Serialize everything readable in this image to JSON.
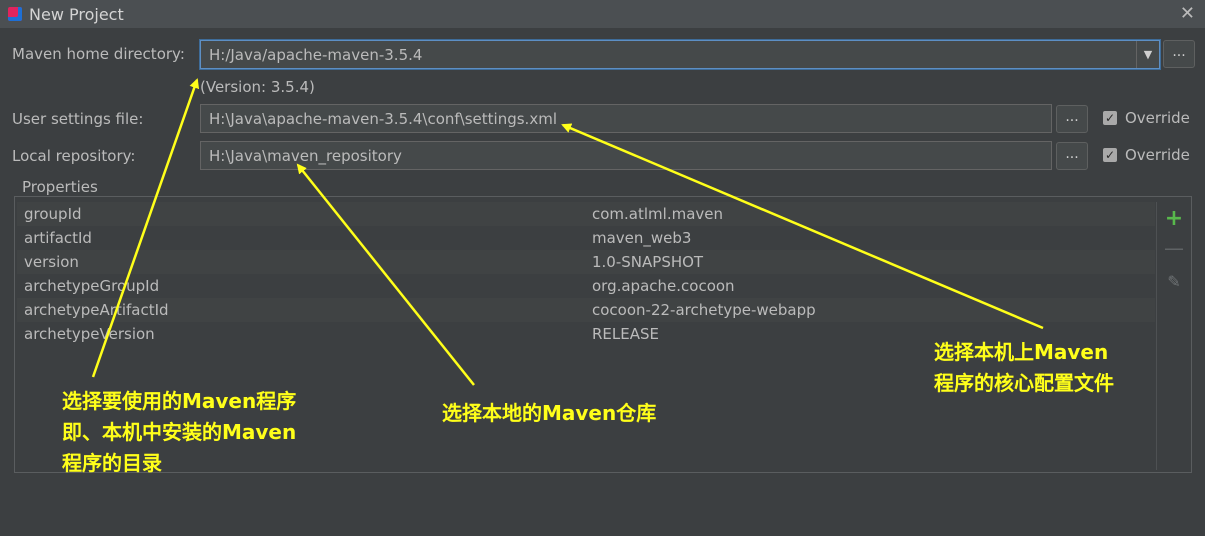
{
  "window": {
    "title": "New Project",
    "close_glyph": "✕"
  },
  "form": {
    "maven_home_label": "Maven home directory:",
    "maven_home_value": "H:/Java/apache-maven-3.5.4",
    "version_note": "(Version: 3.5.4)",
    "user_settings_label": "User settings file:",
    "user_settings_value": "H:\\Java\\apache-maven-3.5.4\\conf\\settings.xml",
    "local_repo_label": "Local repository:",
    "local_repo_value": "H:\\Java\\maven_repository",
    "browse_label": "...",
    "override_label": "Override"
  },
  "properties": {
    "title": "Properties",
    "rows": [
      {
        "key": "groupId",
        "value": "com.atlml.maven"
      },
      {
        "key": "artifactId",
        "value": "maven_web3"
      },
      {
        "key": "version",
        "value": "1.0-SNAPSHOT"
      },
      {
        "key": "archetypeGroupId",
        "value": "org.apache.cocoon"
      },
      {
        "key": "archetypeArtifactId",
        "value": "cocoon-22-archetype-webapp"
      },
      {
        "key": "archetypeVersion",
        "value": "RELEASE"
      }
    ],
    "tools": {
      "add": "+",
      "remove": "—",
      "edit": "✎"
    }
  },
  "annotations": {
    "maven_program": [
      "选择要使用的Maven程序",
      "即、本机中安装的Maven",
      "程序的目录"
    ],
    "local_repo": [
      "选择本地的Maven仓库"
    ],
    "settings_file": [
      "选择本机上Maven",
      "程序的核心配置文件"
    ]
  },
  "colors": {
    "annotation": "#ffff1a",
    "focus_border": "#5d8fc4",
    "add_icon": "#58b84c"
  }
}
